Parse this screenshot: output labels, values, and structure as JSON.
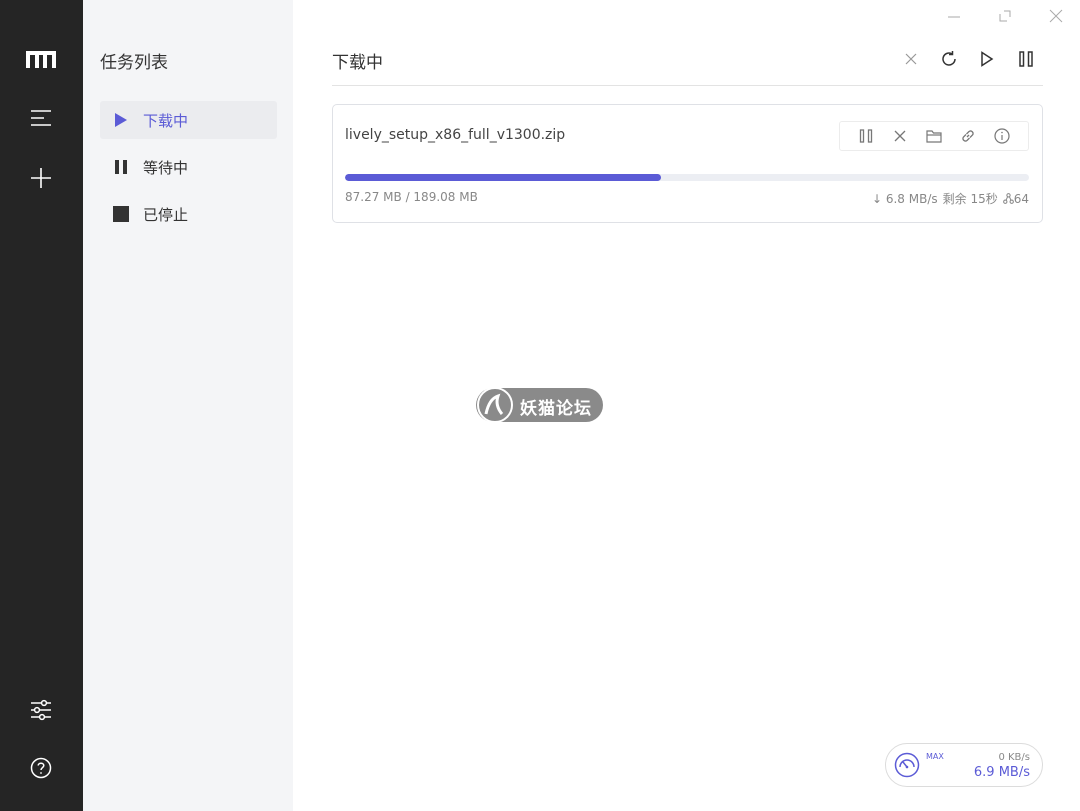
{
  "sidebar": {
    "logo_icon": "motrix-logo-icon",
    "menu_icon": "menu-icon",
    "add_icon": "plus-icon",
    "settings_icon": "sliders-icon",
    "help_icon": "help-circle-icon"
  },
  "tasklist": {
    "title": "任务列表",
    "items": [
      {
        "label": "下载中",
        "icon": "play-icon",
        "active": true
      },
      {
        "label": "等待中",
        "icon": "pause-icon",
        "active": false
      },
      {
        "label": "已停止",
        "icon": "stop-icon",
        "active": false
      }
    ]
  },
  "main": {
    "title": "下载中",
    "toolbar": [
      "close-icon",
      "refresh-icon",
      "play-icon",
      "pause-icon"
    ]
  },
  "task": {
    "filename": "lively_setup_x86_full_v1300.zip",
    "size_text": "87.27 MB / 189.08 MB",
    "progress": 0.4616,
    "speed": "↓ 6.8 MB/s",
    "remaining": "剩余 15秒",
    "connections": "64",
    "actions": [
      "pause-icon",
      "delete-icon",
      "folder-icon",
      "link-icon",
      "info-icon"
    ]
  },
  "speed_meter": {
    "max_label": "MAX",
    "upload": "0 KB/s",
    "download": "6.9 MB/s"
  },
  "watermark": {
    "text": "妖猫论坛"
  },
  "colors": {
    "accent": "#5b5bd6",
    "rail_bg": "#252525",
    "tasklist_bg": "#f4f5f7"
  }
}
